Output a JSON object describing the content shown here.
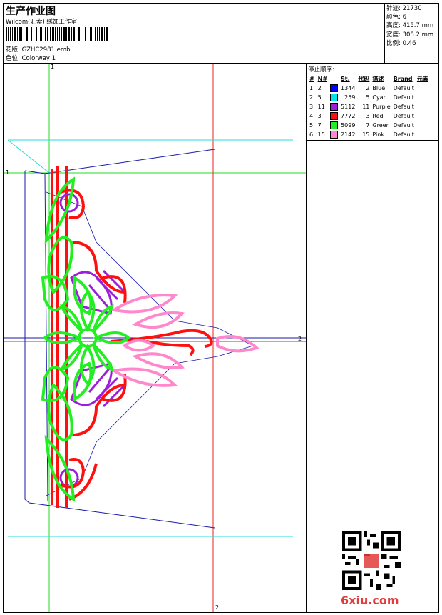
{
  "header": {
    "title": "生产作业图",
    "subtitle": "Wilcom(汇索) 绣饰工作室",
    "design_label": "花版: GZHC2981.emb",
    "colorway_label": "色位: Colorway 1"
  },
  "stats": {
    "stitches": "针迹: 21730",
    "colors": "颜色: 6",
    "height": "高度: 415.7 mm",
    "width": "宽度: 308.2 mm",
    "scale": "比例: 0.46"
  },
  "sidebar": {
    "stop_sequence_label": "停止顺序:",
    "columns": [
      "#",
      "N#",
      "St.",
      "代码",
      "描述",
      "Brand",
      "元素"
    ],
    "rows": [
      {
        "idx": "1.",
        "n": "2",
        "st": "1344",
        "code": "2",
        "desc": "Blue",
        "brand": "Default",
        "color": "#0000ff"
      },
      {
        "idx": "2.",
        "n": "5",
        "st": "259",
        "code": "5",
        "desc": "Cyan",
        "brand": "Default",
        "color": "#00e5e5"
      },
      {
        "idx": "3.",
        "n": "11",
        "st": "5112",
        "code": "11",
        "desc": "Purple",
        "brand": "Default",
        "color": "#9b1fd8"
      },
      {
        "idx": "4.",
        "n": "3",
        "st": "7772",
        "code": "3",
        "desc": "Red",
        "brand": "Default",
        "color": "#ff1010"
      },
      {
        "idx": "5.",
        "n": "7",
        "st": "5099",
        "code": "7",
        "desc": "Green",
        "brand": "Default",
        "color": "#22ee22"
      },
      {
        "idx": "6.",
        "n": "15",
        "st": "2142",
        "code": "15",
        "desc": "Pink",
        "brand": "Default",
        "color": "#ff88cc"
      }
    ]
  },
  "canvas": {
    "axis_labels": {
      "top": "1",
      "left": "1",
      "right": "2",
      "bottom": "2"
    },
    "colors": {
      "guide_green": "#22dd22",
      "guide_red": "#ee2222",
      "guide_cyan": "#22dddd",
      "outline_blue": "#1a1aaa"
    }
  },
  "watermark": "6xiu.com"
}
